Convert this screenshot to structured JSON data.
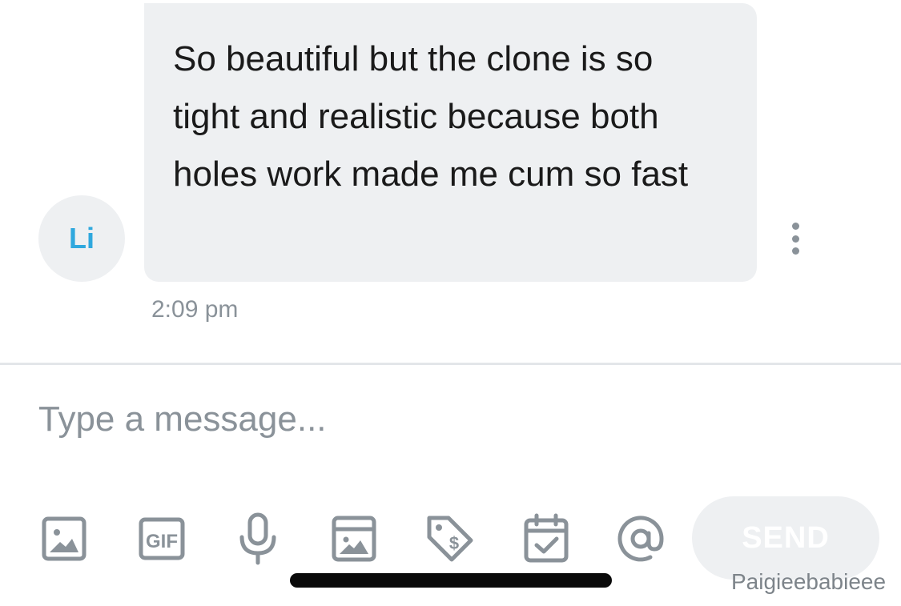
{
  "message": {
    "avatar_initials": "Li",
    "text": "So beautiful but the clone is so tight and realistic because both holes work made me cum so fast",
    "timestamp": "2:09 pm",
    "more_icon": "more-vertical-icon"
  },
  "composer": {
    "placeholder": "Type a message...",
    "tools": [
      {
        "name": "image-icon"
      },
      {
        "name": "gif-icon",
        "label": "GIF"
      },
      {
        "name": "microphone-icon"
      },
      {
        "name": "vault-media-icon"
      },
      {
        "name": "price-tag-icon"
      },
      {
        "name": "schedule-calendar-icon"
      },
      {
        "name": "mention-icon"
      }
    ],
    "send_label": "SEND"
  },
  "watermark": "Paigieebabieee",
  "colors": {
    "bubble": "#eef0f2",
    "avatar_text": "#2fa8de",
    "icon": "#8a9299",
    "text": "#1a1a1a"
  }
}
